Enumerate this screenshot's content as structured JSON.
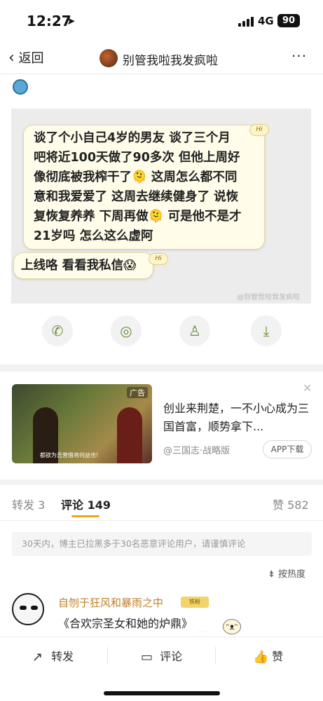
{
  "status_bar": {
    "time": "12:27",
    "network": "4G",
    "battery": "90"
  },
  "nav": {
    "back_label": "返回",
    "title": "别管我啦我发疯啦",
    "more": "···"
  },
  "post_image": {
    "bubble1_text": "谈了个小自己4岁的男友 谈了三个月\n吧将近100天做了90多次 但他上周好\n像彻底被我榨干了🫠 这周怎么都不同\n意和我爱爱了 这周去继续健身了 说恢\n复恢复养养 下周再做🫠 可是他不是才\n21岁吗 怎么这么虚阿",
    "bubble2_text": "上线咯 看看我私信😱",
    "hi_tag": "Hi",
    "watermark": "@别管我啦我发疯啦"
  },
  "share_icons": [
    "wechat-icon",
    "moments-icon",
    "qq-icon",
    "save-image-icon"
  ],
  "ad": {
    "tag": "广告",
    "title": "创业来荆楚，一不小心成为三国首富，顺势拿下...",
    "source": "@三国志·战略版",
    "button": "APP下载",
    "image_caption": "都欲为吾营借将何益也!"
  },
  "tabs": {
    "repost": "转发 3",
    "comment": "评论 149",
    "like": "赞 582"
  },
  "notice": "30天内，博主已拉黑多于30名恶意评论用户，请谨慎评论",
  "sort_label": "按热度",
  "comment": {
    "username": "自刎于狂风和暴雨之中",
    "badge": "铁粉",
    "text": "《合欢宗圣女和她的炉鼎》"
  },
  "bottom_bar": {
    "repost": "转发",
    "comment": "评论",
    "like": "赞"
  }
}
